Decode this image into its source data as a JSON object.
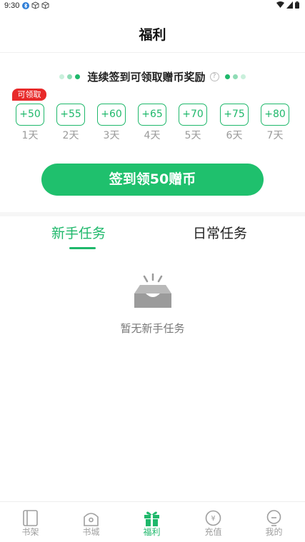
{
  "status_bar": {
    "time": "9:30"
  },
  "header": {
    "title": "福利"
  },
  "signin": {
    "title": "连续签到可领取赠币奖励",
    "help": "?",
    "claim_tag": "可领取",
    "days": [
      {
        "reward": "+50",
        "label": "1天"
      },
      {
        "reward": "+55",
        "label": "2天"
      },
      {
        "reward": "+60",
        "label": "3天"
      },
      {
        "reward": "+65",
        "label": "4天"
      },
      {
        "reward": "+70",
        "label": "5天"
      },
      {
        "reward": "+75",
        "label": "6天"
      },
      {
        "reward": "+80",
        "label": "7天"
      }
    ],
    "button": "签到领50赠币"
  },
  "tabs": {
    "new": "新手任务",
    "daily": "日常任务"
  },
  "empty": {
    "text": "暂无新手任务"
  },
  "nav": {
    "shelf": "书架",
    "store": "书城",
    "welfare": "福利",
    "recharge": "充值",
    "mine": "我的"
  },
  "colors": {
    "accent": "#1fb86b",
    "button": "#1fc06d",
    "tag": "#e82a2a"
  }
}
